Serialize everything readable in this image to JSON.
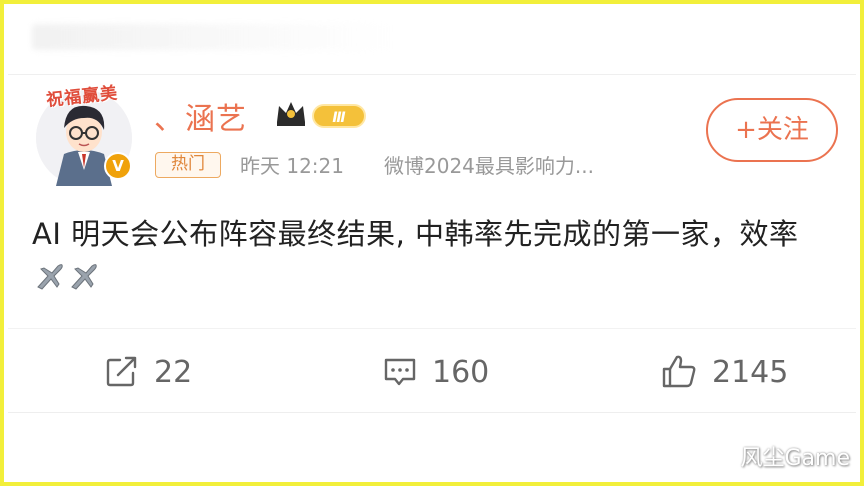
{
  "post": {
    "username": "、涵艺",
    "level": "Ⅲ",
    "hot_tag": "热门",
    "time": "昨天 12:21",
    "source": "微博2024最具影响力...",
    "follow_label": "+关注",
    "avatar_caption": "祝福赢美",
    "verified_mark": "V",
    "text": "AI 明天会公布阵容最终结果, 中韩率先完成的第一家，效率",
    "icons": [
      "crown-icon",
      "plane-icon",
      "share-icon",
      "comment-icon",
      "like-icon"
    ]
  },
  "actions": {
    "share_count": "22",
    "comment_count": "160",
    "like_count": "2145"
  },
  "watermark": "风尘Game",
  "colors": {
    "frame": "#f2ef3a",
    "accent": "#eb7350",
    "hot_tag": "#e0873b",
    "meta": "#999999",
    "action": "#666666"
  }
}
